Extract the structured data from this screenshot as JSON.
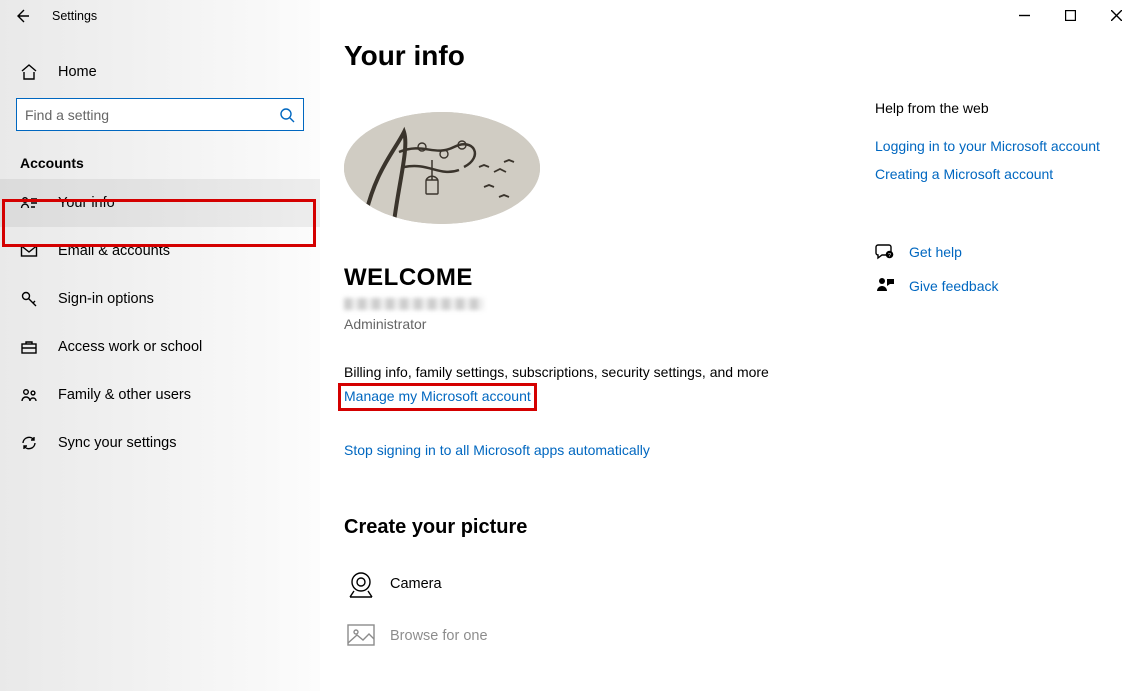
{
  "app_title": "Settings",
  "search": {
    "placeholder": "Find a setting"
  },
  "home_label": "Home",
  "category": "Accounts",
  "nav": {
    "your_info": "Your info",
    "email": "Email & accounts",
    "signin": "Sign-in options",
    "work": "Access work or school",
    "family": "Family & other users",
    "sync": "Sync your settings"
  },
  "page": {
    "title": "Your info",
    "user_name": "WELCOME",
    "role": "Administrator",
    "billing_text": "Billing info, family settings, subscriptions, security settings, and more",
    "manage_link": "Manage my Microsoft account",
    "stop_link": "Stop signing in to all Microsoft apps automatically",
    "create_picture_title": "Create your picture",
    "camera": "Camera",
    "browse": "Browse for one"
  },
  "help": {
    "title": "Help from the web",
    "link1": "Logging in to your Microsoft account",
    "link2": "Creating a Microsoft account",
    "get_help": "Get help",
    "feedback": "Give feedback"
  }
}
